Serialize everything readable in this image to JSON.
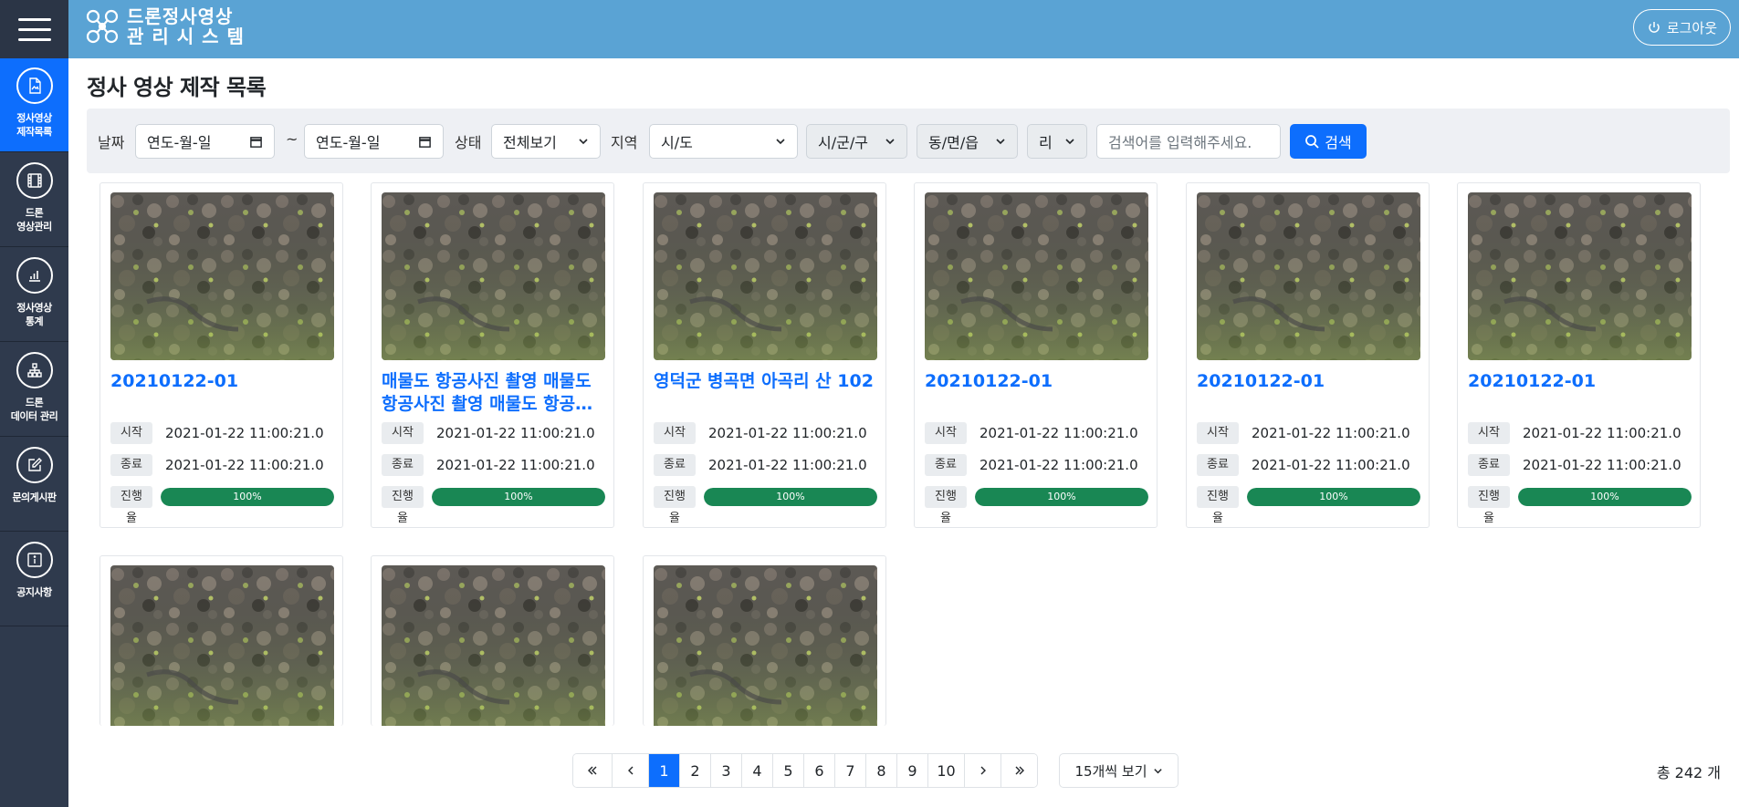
{
  "header": {
    "logo_line1": "드론정사영상",
    "logo_line2": "관 리 시 스 템",
    "logout_label": "로그아웃"
  },
  "sidebar": {
    "items": [
      {
        "label": "정사영상\n제작목록",
        "icon": "file-image-icon",
        "active": true
      },
      {
        "label": "드론\n영상관리",
        "icon": "film-icon",
        "active": false
      },
      {
        "label": "정사영상\n통계",
        "icon": "bar-chart-icon",
        "active": false
      },
      {
        "label": "드론\n데이터 관리",
        "icon": "diagram-icon",
        "active": false
      },
      {
        "label": "문의게시판",
        "icon": "pencil-square-icon",
        "active": false
      },
      {
        "label": "공지사항",
        "icon": "info-square-icon",
        "active": false
      }
    ]
  },
  "page_title": "정사 영상 제작 목록",
  "filters": {
    "date_label": "날짜",
    "date_from_placeholder": "연도-월-일",
    "tilde": "~",
    "date_to_placeholder": "연도-월-일",
    "status_label": "상태",
    "status_value": "전체보기",
    "region_label": "지역",
    "sido_value": "시/도",
    "sigungu_value": "시/군/구",
    "dong_value": "동/면/읍",
    "ri_value": "리",
    "search_placeholder": "검색어를 입력해주세요.",
    "search_button": "검색"
  },
  "cards": [
    {
      "title": "20210122-01",
      "start_label": "시작",
      "start": "2021-01-22 11:00:21.0",
      "end_label": "종료",
      "end": "2021-01-22 11:00:21.0",
      "progress_label": "진행율",
      "progress": "100%"
    },
    {
      "title": "매물도 항공사진 촬영 매물도 항공사진 촬영 매물도 항공사진 촬영",
      "start_label": "시작",
      "start": "2021-01-22 11:00:21.0",
      "end_label": "종료",
      "end": "2021-01-22 11:00:21.0",
      "progress_label": "진행율",
      "progress": "100%"
    },
    {
      "title": "영덕군 병곡면 아곡리 산 102",
      "start_label": "시작",
      "start": "2021-01-22 11:00:21.0",
      "end_label": "종료",
      "end": "2021-01-22 11:00:21.0",
      "progress_label": "진행율",
      "progress": "100%"
    },
    {
      "title": "20210122-01",
      "start_label": "시작",
      "start": "2021-01-22 11:00:21.0",
      "end_label": "종료",
      "end": "2021-01-22 11:00:21.0",
      "progress_label": "진행율",
      "progress": "100%"
    },
    {
      "title": "20210122-01",
      "start_label": "시작",
      "start": "2021-01-22 11:00:21.0",
      "end_label": "종료",
      "end": "2021-01-22 11:00:21.0",
      "progress_label": "진행율",
      "progress": "100%"
    },
    {
      "title": "20210122-01",
      "start_label": "시작",
      "start": "2021-01-22 11:00:21.0",
      "end_label": "종료",
      "end": "2021-01-22 11:00:21.0",
      "progress_label": "진행율",
      "progress": "100%"
    }
  ],
  "pagination": {
    "pages": [
      "1",
      "2",
      "3",
      "4",
      "5",
      "6",
      "7",
      "8",
      "9",
      "10"
    ],
    "current": "1",
    "page_size": "15개씩 보기",
    "total": "총 242 개"
  }
}
